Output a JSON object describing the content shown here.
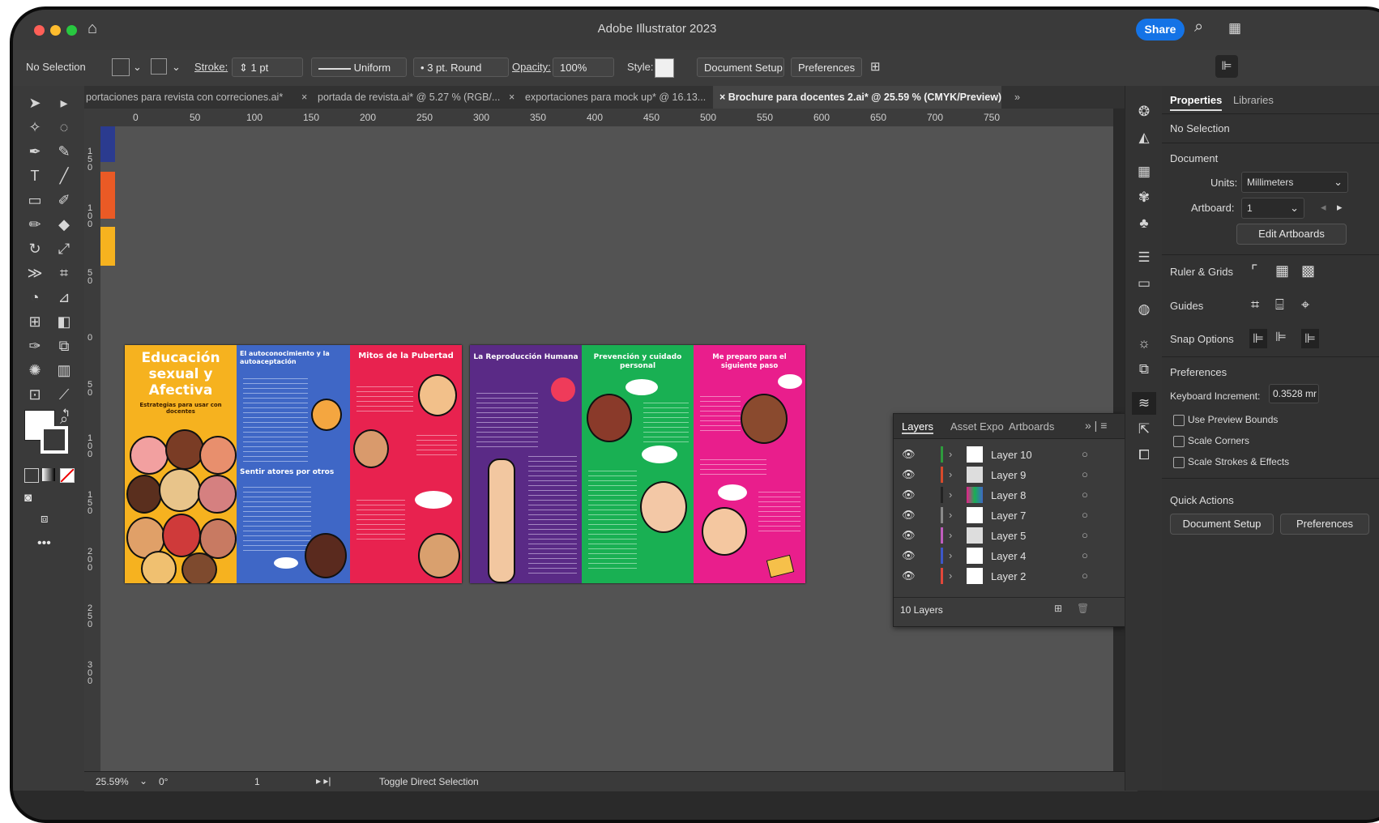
{
  "window": {
    "title": "Adobe Illustrator 2023",
    "share_label": "Share"
  },
  "control_bar": {
    "selection": "No Selection",
    "stroke_label": "Stroke:",
    "stroke_value": "1 pt",
    "stroke_profile": "Uniform",
    "brush": "3 pt. Round",
    "opacity_label": "Opacity:",
    "opacity_value": "100%",
    "style_label": "Style:",
    "document_setup": "Document Setup",
    "preferences": "Preferences"
  },
  "tabs": [
    {
      "label": "portaciones para revista con correciones.ai*",
      "active": false
    },
    {
      "label": "portada de revista.ai* @ 5.27 % (RGB/...",
      "active": false
    },
    {
      "label": "exportaciones para mock up* @ 16.13...",
      "active": false
    },
    {
      "label": "Brochure para docentes 2.ai* @ 25.59 % (CMYK/Preview)",
      "active": true
    }
  ],
  "ruler": {
    "h_ticks": [
      "0",
      "50",
      "100",
      "150",
      "200",
      "250",
      "300",
      "350",
      "400",
      "450",
      "500",
      "550",
      "600",
      "650",
      "700",
      "750"
    ]
  },
  "ruler_v_ticks": [
    "150",
    "100",
    "50",
    "0",
    "50",
    "100",
    "150",
    "200",
    "250",
    "300"
  ],
  "properties": {
    "tab_properties": "Properties",
    "tab_libraries": "Libraries",
    "no_selection": "No Selection",
    "document": "Document",
    "units_label": "Units:",
    "units_value": "Millimeters",
    "artboard_label": "Artboard:",
    "artboard_value": "1",
    "edit_artboards": "Edit Artboards",
    "ruler_grids": "Ruler & Grids",
    "guides": "Guides",
    "snap_options": "Snap Options",
    "preferences": "Preferences",
    "keyboard_increment_label": "Keyboard Increment:",
    "keyboard_increment_value": "0.3528 mr",
    "use_preview_bounds": "Use Preview Bounds",
    "scale_corners": "Scale Corners",
    "scale_strokes": "Scale Strokes & Effects",
    "quick_actions": "Quick Actions",
    "qa_document_setup": "Document Setup",
    "qa_preferences": "Preferences"
  },
  "layers": {
    "tabs": [
      "Layers",
      "Asset Expo",
      "Artboards"
    ],
    "rows": [
      {
        "name": "Layer 10",
        "color": "#2e9b3d"
      },
      {
        "name": "Layer 9",
        "color": "#d84a2b"
      },
      {
        "name": "Layer 8",
        "color": "#222222"
      },
      {
        "name": "Layer 7",
        "color": "#8a8a8a"
      },
      {
        "name": "Layer 5",
        "color": "#c05dbd"
      },
      {
        "name": "Layer 4",
        "color": "#3d57c9"
      },
      {
        "name": "Layer 2",
        "color": "#e2473a"
      }
    ],
    "count": "10 Layers"
  },
  "status": {
    "zoom": "25.59%",
    "rotation": "0°",
    "artboard": "1",
    "tool_hint": "Toggle Direct Selection"
  },
  "brochure": {
    "panel1_title": "Educación sexual y Afectiva",
    "panel1_subtitle": "Estrategias para usar con docentes",
    "panel2_title": "El autoconocimiento y la autoaceptación",
    "panel2_section": "Sentir atores por otros",
    "panel3_title": "Mitos de la Pubertad",
    "panel4_title": "La Reproducción Humana",
    "panel5_title": "Prevención y cuidado personal",
    "panel6_title": "Me preparo para el siguiente paso"
  },
  "colors": {
    "yellow": "#f6b21f",
    "blue": "#3f67c6",
    "red": "#e8224f",
    "purple": "#5a2a86",
    "green": "#19b053",
    "pink": "#e91e8c",
    "canvas": "#535353"
  }
}
